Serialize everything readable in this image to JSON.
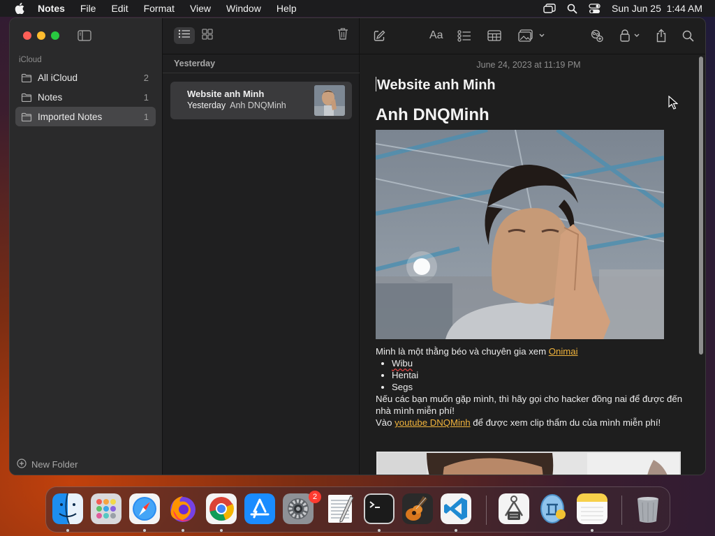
{
  "menubar": {
    "app_name": "Notes",
    "items": [
      "File",
      "Edit",
      "Format",
      "View",
      "Window",
      "Help"
    ],
    "clock": "Sun Jun 25  1:44 AM"
  },
  "sidebar": {
    "section_label": "iCloud",
    "folders": [
      {
        "name": "All iCloud",
        "count": "2",
        "selected": false
      },
      {
        "name": "Notes",
        "count": "1",
        "selected": false
      },
      {
        "name": "Imported Notes",
        "count": "1",
        "selected": true
      }
    ],
    "new_folder_label": "New Folder"
  },
  "note_list": {
    "group_header": "Yesterday",
    "notes": [
      {
        "title": "Website anh Minh",
        "date": "Yesterday",
        "preview": "Anh DNQMinh"
      }
    ]
  },
  "editor": {
    "timestamp": "June 24, 2023 at 11:19 PM",
    "title": "Website anh Minh",
    "heading": "Anh DNQMinh",
    "paragraph1_text": "Minh là một thằng béo và chuyên gia xem ",
    "paragraph1_link": "Onimai",
    "bullets": [
      "Wibu",
      "Hentai",
      "Segs"
    ],
    "paragraph2": "Nếu các bạn muốn gặp mình, thì hãy gọi cho hacker đồng nai để được đến nhà mình miễn phí!",
    "paragraph3_pre": "Vào ",
    "paragraph3_link": "youtube DNQMinh",
    "paragraph3_post": " để được xem clip thẩm du của mình miễn phí!",
    "font_button_label": "Aa"
  },
  "dock": {
    "apps": [
      "Finder",
      "Launchpad",
      "Safari",
      "Firefox",
      "Chrome",
      "App Store",
      "System Settings",
      "TextEdit",
      "Terminal",
      "GarageBand",
      "Visual Studio Code",
      "Archive Utility",
      "Xcode Simulator",
      "Notes",
      "Trash"
    ],
    "system_settings_badge": "2"
  },
  "colors": {
    "link": "#f0b33c",
    "selection": "#464648",
    "close": "#ff5f57",
    "minimize": "#febc2e",
    "zoom": "#28c840"
  }
}
